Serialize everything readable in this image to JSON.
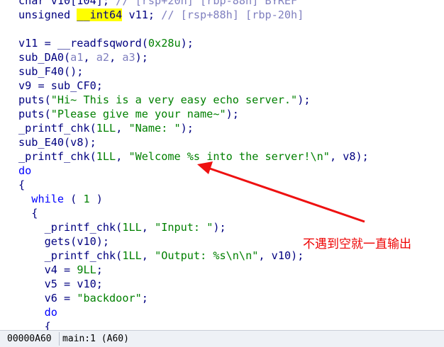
{
  "code_lines": [
    [
      [
        "type",
        "char"
      ],
      [
        "punc",
        " v10[104]; "
      ],
      [
        "cmt",
        "// [rsp+20h] [rbp-88h] BYREF"
      ]
    ],
    [
      [
        "type",
        "unsigned "
      ],
      [
        "hl",
        "__int64"
      ],
      [
        "punc",
        " v11; "
      ],
      [
        "cmt",
        "// [rsp+88h] [rbp-20h]"
      ]
    ],
    [],
    [
      [
        "var",
        "v11"
      ],
      [
        "punc",
        " = "
      ],
      [
        "fn",
        "__readfsqword"
      ],
      [
        "punc",
        "("
      ],
      [
        "num",
        "0x28u"
      ],
      [
        "punc",
        ");"
      ]
    ],
    [
      [
        "fn",
        "sub_DA0"
      ],
      [
        "punc",
        "("
      ],
      [
        "arg",
        "a1"
      ],
      [
        "punc",
        ", "
      ],
      [
        "arg",
        "a2"
      ],
      [
        "punc",
        ", "
      ],
      [
        "arg",
        "a3"
      ],
      [
        "punc",
        ");"
      ]
    ],
    [
      [
        "fn",
        "sub_F40"
      ],
      [
        "punc",
        "();"
      ]
    ],
    [
      [
        "var",
        "v9"
      ],
      [
        "punc",
        " = "
      ],
      [
        "fn",
        "sub_CF0"
      ],
      [
        "punc",
        ";"
      ]
    ],
    [
      [
        "fn",
        "puts"
      ],
      [
        "punc",
        "("
      ],
      [
        "str",
        "\"Hi~ This is a very easy echo server.\""
      ],
      [
        "punc",
        ");"
      ]
    ],
    [
      [
        "fn",
        "puts"
      ],
      [
        "punc",
        "("
      ],
      [
        "str",
        "\"Please give me your name~\""
      ],
      [
        "punc",
        ");"
      ]
    ],
    [
      [
        "fn",
        "_printf_chk"
      ],
      [
        "punc",
        "("
      ],
      [
        "num",
        "1LL"
      ],
      [
        "punc",
        ", "
      ],
      [
        "str",
        "\"Name: \""
      ],
      [
        "punc",
        ");"
      ]
    ],
    [
      [
        "fn",
        "sub_E40"
      ],
      [
        "punc",
        "("
      ],
      [
        "var",
        "v8"
      ],
      [
        "punc",
        ");"
      ]
    ],
    [
      [
        "fn",
        "_printf_chk"
      ],
      [
        "punc",
        "("
      ],
      [
        "num",
        "1LL"
      ],
      [
        "punc",
        ", "
      ],
      [
        "str",
        "\"Welcome %s into the server!\\n\""
      ],
      [
        "punc",
        ", "
      ],
      [
        "var",
        "v8"
      ],
      [
        "punc",
        ");"
      ]
    ],
    [
      [
        "kw",
        "do"
      ]
    ],
    [
      [
        "punc",
        "{"
      ]
    ],
    [
      [
        "punc",
        "  "
      ],
      [
        "kw",
        "while"
      ],
      [
        "punc",
        " ( "
      ],
      [
        "num",
        "1"
      ],
      [
        "punc",
        " )"
      ]
    ],
    [
      [
        "punc",
        "  {"
      ]
    ],
    [
      [
        "punc",
        "    "
      ],
      [
        "fn",
        "_printf_chk"
      ],
      [
        "punc",
        "("
      ],
      [
        "num",
        "1LL"
      ],
      [
        "punc",
        ", "
      ],
      [
        "str",
        "\"Input: \""
      ],
      [
        "punc",
        ");"
      ]
    ],
    [
      [
        "punc",
        "    "
      ],
      [
        "fn",
        "gets"
      ],
      [
        "punc",
        "("
      ],
      [
        "var",
        "v10"
      ],
      [
        "punc",
        ");"
      ]
    ],
    [
      [
        "punc",
        "    "
      ],
      [
        "fn",
        "_printf_chk"
      ],
      [
        "punc",
        "("
      ],
      [
        "num",
        "1LL"
      ],
      [
        "punc",
        ", "
      ],
      [
        "str",
        "\"Output: %s\\n\\n\""
      ],
      [
        "punc",
        ", "
      ],
      [
        "var",
        "v10"
      ],
      [
        "punc",
        ");"
      ]
    ],
    [
      [
        "punc",
        "    "
      ],
      [
        "var",
        "v4"
      ],
      [
        "punc",
        " = "
      ],
      [
        "num",
        "9LL"
      ],
      [
        "punc",
        ";"
      ]
    ],
    [
      [
        "punc",
        "    "
      ],
      [
        "var",
        "v5"
      ],
      [
        "punc",
        " = "
      ],
      [
        "var",
        "v10"
      ],
      [
        "punc",
        ";"
      ]
    ],
    [
      [
        "punc",
        "    "
      ],
      [
        "var",
        "v6"
      ],
      [
        "punc",
        " = "
      ],
      [
        "str",
        "\"backdoor\""
      ],
      [
        "punc",
        ";"
      ]
    ],
    [
      [
        "punc",
        "    "
      ],
      [
        "kw",
        "do"
      ]
    ],
    [
      [
        "punc",
        "    {"
      ]
    ]
  ],
  "status": {
    "address": "00000A60",
    "location": "main:1 (A60)"
  },
  "annotation": {
    "text": "不遇到空就一直输出",
    "color": "#ee0000"
  },
  "colors": {
    "background": "#ffffff",
    "keyword": "#0000ff",
    "identifier": "#000080",
    "string": "#008000",
    "comment": "#7f7fbf",
    "highlight": "#ffff00"
  }
}
